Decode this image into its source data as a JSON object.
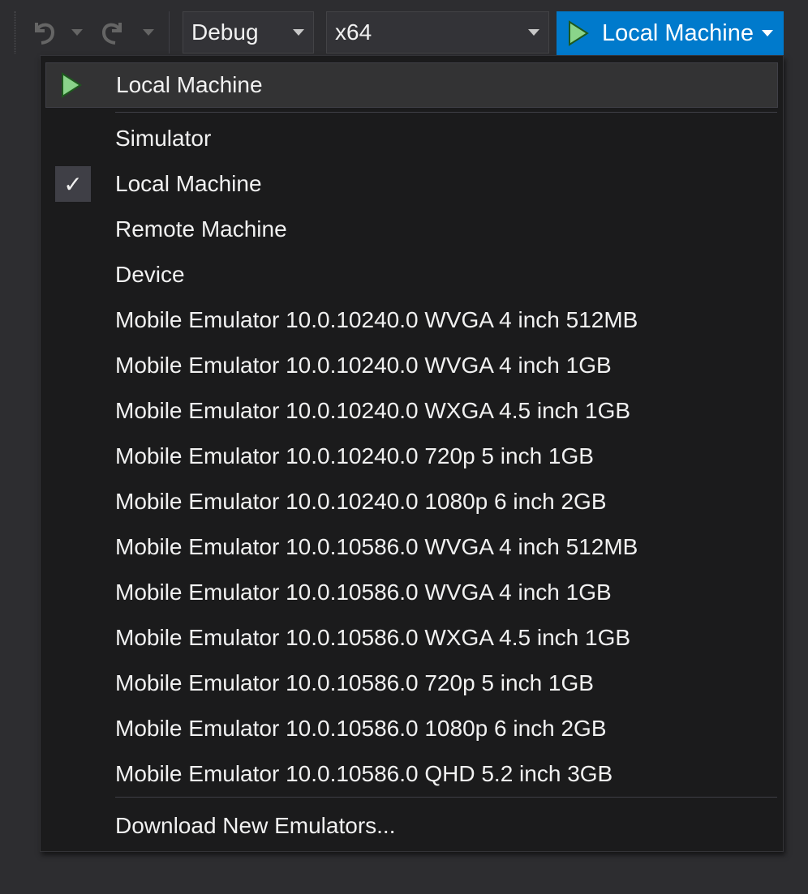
{
  "toolbar": {
    "undo_icon": "undo-icon",
    "redo_icon": "redo-icon",
    "configuration": "Debug",
    "platform": "x64",
    "run_target": "Local Machine",
    "run_icon": "play-icon"
  },
  "menu": {
    "header_item": {
      "label": "Local Machine",
      "icon": "play-icon"
    },
    "items": [
      {
        "label": "Simulator",
        "checked": false
      },
      {
        "label": "Local Machine",
        "checked": true
      },
      {
        "label": "Remote Machine",
        "checked": false
      },
      {
        "label": "Device",
        "checked": false
      },
      {
        "label": "Mobile Emulator 10.0.10240.0 WVGA 4 inch 512MB",
        "checked": false
      },
      {
        "label": "Mobile Emulator 10.0.10240.0 WVGA 4 inch 1GB",
        "checked": false
      },
      {
        "label": "Mobile Emulator 10.0.10240.0 WXGA 4.5 inch 1GB",
        "checked": false
      },
      {
        "label": "Mobile Emulator 10.0.10240.0 720p 5 inch 1GB",
        "checked": false
      },
      {
        "label": "Mobile Emulator 10.0.10240.0 1080p 6 inch 2GB",
        "checked": false
      },
      {
        "label": "Mobile Emulator 10.0.10586.0 WVGA 4 inch 512MB",
        "checked": false
      },
      {
        "label": "Mobile Emulator 10.0.10586.0 WVGA 4 inch 1GB",
        "checked": false
      },
      {
        "label": "Mobile Emulator 10.0.10586.0 WXGA 4.5 inch 1GB",
        "checked": false
      },
      {
        "label": "Mobile Emulator 10.0.10586.0 720p 5 inch 1GB",
        "checked": false
      },
      {
        "label": "Mobile Emulator 10.0.10586.0 1080p 6 inch 2GB",
        "checked": false
      },
      {
        "label": "Mobile Emulator 10.0.10586.0 QHD 5.2 inch 3GB",
        "checked": false
      }
    ],
    "footer_item": {
      "label": "Download New Emulators..."
    },
    "check_glyph": "✓"
  },
  "colors": {
    "background": "#2d2d30",
    "menu_background": "#1b1b1c",
    "accent": "#007acc",
    "play_green": "#8ad48a",
    "text": "#f1f1f1"
  }
}
